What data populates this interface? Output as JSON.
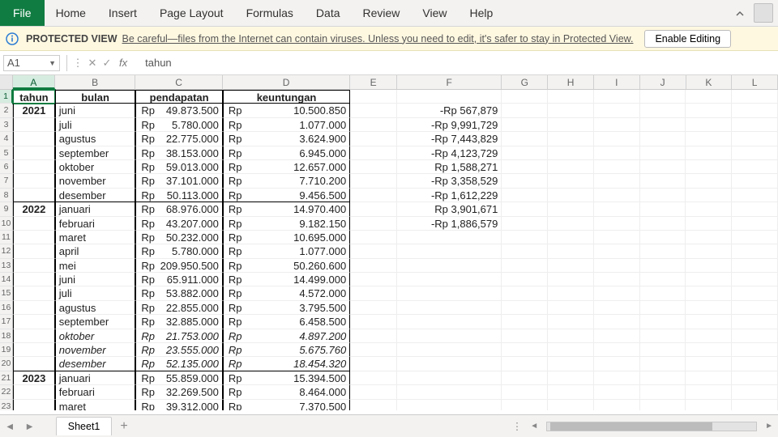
{
  "ribbon": {
    "file": "File",
    "tabs": [
      "Home",
      "Insert",
      "Page Layout",
      "Formulas",
      "Data",
      "Review",
      "View",
      "Help"
    ]
  },
  "protected_view": {
    "label": "PROTECTED VIEW",
    "message": "Be careful—files from the Internet can contain viruses. Unless you need to edit, it's safer to stay in Protected View.",
    "button": "Enable Editing"
  },
  "name_box": "A1",
  "fx_content": "tahun",
  "column_headers": [
    "A",
    "B",
    "C",
    "D",
    "E",
    "F",
    "G",
    "H",
    "I",
    "J",
    "K",
    "L"
  ],
  "row_headers": [
    "1",
    "2",
    "3",
    "4",
    "5",
    "6",
    "7",
    "8",
    "9",
    "10",
    "11",
    "12",
    "13",
    "14",
    "15",
    "16",
    "17",
    "18",
    "19",
    "20",
    "21",
    "22",
    "23"
  ],
  "headers": {
    "a": "tahun",
    "b": "bulan",
    "c": "pendapatan",
    "d": "keuntungan"
  },
  "currency": "Rp",
  "rows": [
    {
      "tahun": "2021",
      "bulan": "juni",
      "pendapatan": "49.873.500",
      "keuntungan": "10.500.850",
      "f": "-Rp 567,879"
    },
    {
      "tahun": "",
      "bulan": "juli",
      "pendapatan": "5.780.000",
      "keuntungan": "1.077.000",
      "f": "-Rp 9,991,729"
    },
    {
      "tahun": "",
      "bulan": "agustus",
      "pendapatan": "22.775.000",
      "keuntungan": "3.624.900",
      "f": "-Rp 7,443,829"
    },
    {
      "tahun": "",
      "bulan": "september",
      "pendapatan": "38.153.000",
      "keuntungan": "6.945.000",
      "f": "-Rp 4,123,729"
    },
    {
      "tahun": "",
      "bulan": "oktober",
      "pendapatan": "59.013.000",
      "keuntungan": "12.657.000",
      "f": "Rp 1,588,271"
    },
    {
      "tahun": "",
      "bulan": "november",
      "pendapatan": "37.101.000",
      "keuntungan": "7.710.200",
      "f": "-Rp 3,358,529"
    },
    {
      "tahun": "",
      "bulan": "desember",
      "pendapatan": "50.113.000",
      "keuntungan": "9.456.500",
      "f": "-Rp 1,612,229",
      "bottom": true
    },
    {
      "tahun": "2022",
      "bulan": "januari",
      "pendapatan": "68.976.000",
      "keuntungan": "14.970.400",
      "f": "Rp 3,901,671"
    },
    {
      "tahun": "",
      "bulan": "februari",
      "pendapatan": "43.207.000",
      "keuntungan": "9.182.150",
      "f": "-Rp 1,886,579"
    },
    {
      "tahun": "",
      "bulan": "maret",
      "pendapatan": "50.232.000",
      "keuntungan": "10.695.000",
      "f": ""
    },
    {
      "tahun": "",
      "bulan": "april",
      "pendapatan": "5.780.000",
      "keuntungan": "1.077.000",
      "f": ""
    },
    {
      "tahun": "",
      "bulan": "mei",
      "pendapatan": "209.950.500",
      "keuntungan": "50.260.600",
      "f": ""
    },
    {
      "tahun": "",
      "bulan": "juni",
      "pendapatan": "65.911.000",
      "keuntungan": "14.499.000",
      "f": ""
    },
    {
      "tahun": "",
      "bulan": "juli",
      "pendapatan": "53.882.000",
      "keuntungan": "4.572.000",
      "f": ""
    },
    {
      "tahun": "",
      "bulan": "agustus",
      "pendapatan": "22.855.000",
      "keuntungan": "3.795.500",
      "f": ""
    },
    {
      "tahun": "",
      "bulan": "september",
      "pendapatan": "32.885.000",
      "keuntungan": "6.458.500",
      "f": ""
    },
    {
      "tahun": "",
      "bulan": "oktober",
      "pendapatan": "21.753.000",
      "keuntungan": "4.897.200",
      "f": "",
      "italic": true
    },
    {
      "tahun": "",
      "bulan": "november",
      "pendapatan": "23.555.000",
      "keuntungan": "5.675.760",
      "f": "",
      "italic": true
    },
    {
      "tahun": "",
      "bulan": "desember",
      "pendapatan": "52.135.000",
      "keuntungan": "18.454.320",
      "f": "",
      "italic": true,
      "bottom": true
    },
    {
      "tahun": "2023",
      "bulan": "januari",
      "pendapatan": "55.859.000",
      "keuntungan": "15.394.500",
      "f": ""
    },
    {
      "tahun": "",
      "bulan": "februari",
      "pendapatan": "32.269.500",
      "keuntungan": "8.464.000",
      "f": ""
    },
    {
      "tahun": "",
      "bulan": "maret",
      "pendapatan": "39.312.000",
      "keuntungan": "7.370.500",
      "f": ""
    }
  ],
  "sheet_tab": "Sheet1"
}
